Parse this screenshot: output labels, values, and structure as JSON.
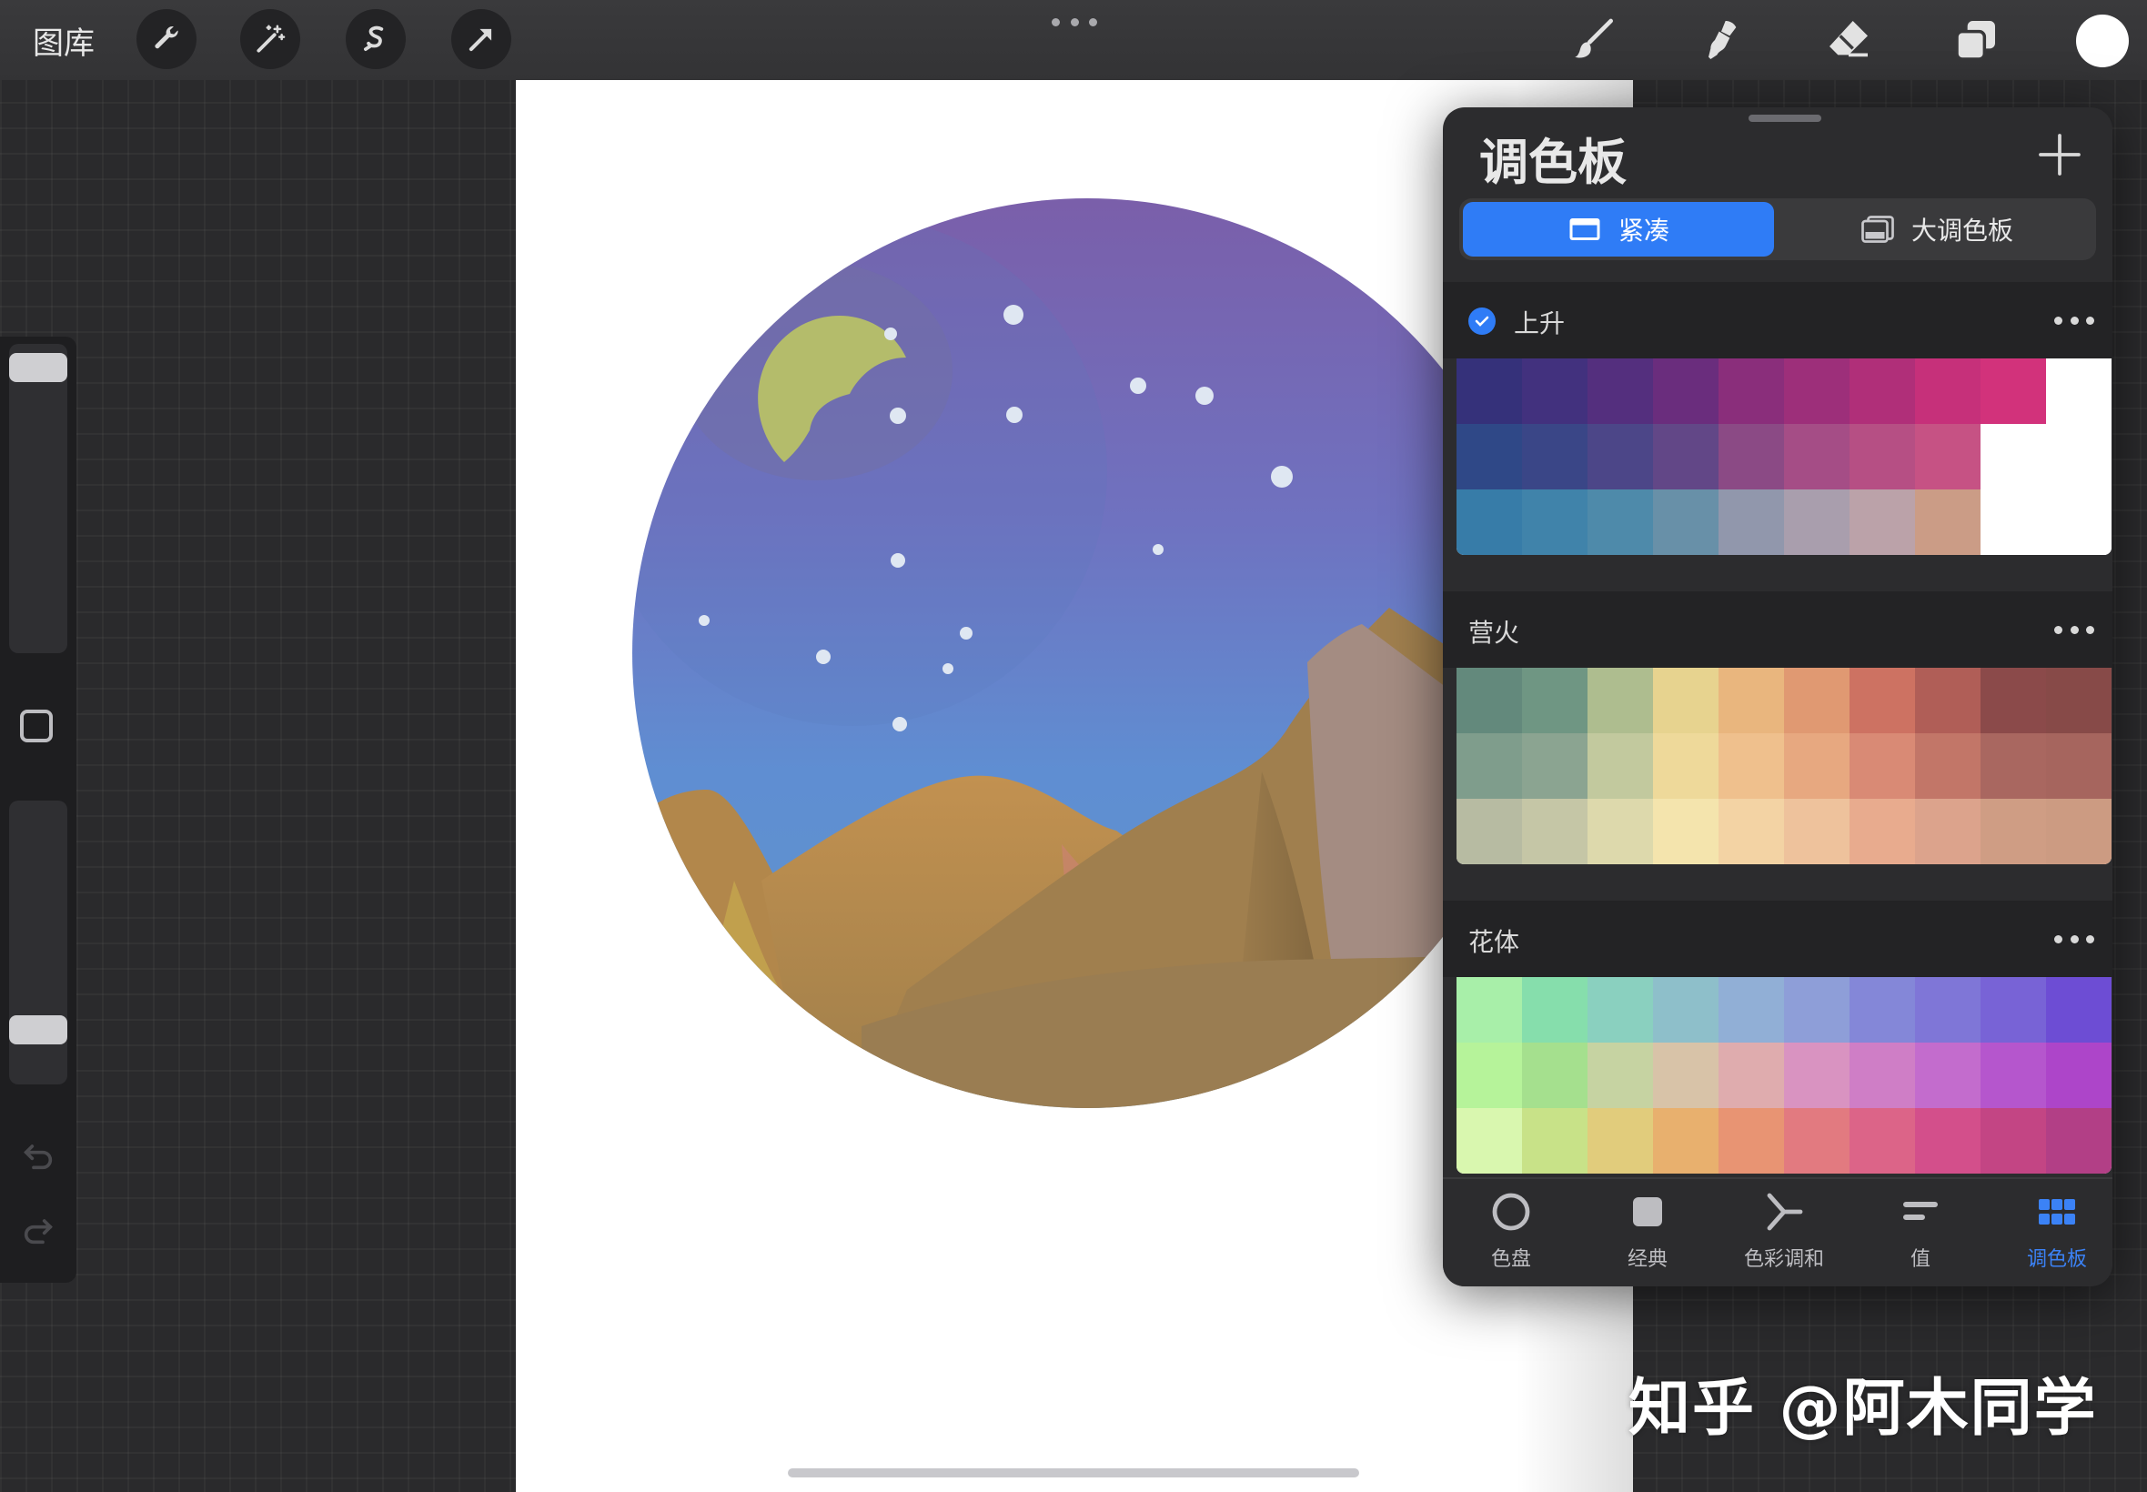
{
  "topbar": {
    "gallery_label": "图库",
    "left_tools": [
      "wrench-icon",
      "magic-wand-icon",
      "selection-icon",
      "transform-icon"
    ],
    "right_tools": [
      "brush-icon",
      "smudge-icon",
      "eraser-icon",
      "layers-icon"
    ],
    "current_color": "#ffffff"
  },
  "panel": {
    "title": "调色板",
    "segments": [
      {
        "label": "紧凑",
        "active": true
      },
      {
        "label": "大调色板",
        "active": false
      }
    ],
    "palettes": [
      {
        "name": "上升",
        "default": true,
        "colors": [
          [
            "#35317a",
            "#42317e",
            "#542f7e",
            "#6a2d7d",
            "#8a2e7b",
            "#9d2f7a",
            "#b02f79",
            "#c6307a",
            "#d2327b",
            "#ffffff"
          ],
          [
            "#2f4887",
            "#3a4687",
            "#4c4688",
            "#624787",
            "#8b4a85",
            "#a54d86",
            "#b64f84",
            "#c65284",
            "#ffffff",
            "#ffffff"
          ],
          [
            "#377ca8",
            "#4083aa",
            "#4e8aaa",
            "#6890a8",
            "#9197ac",
            "#a99ead",
            "#bba2a9",
            "#cb9c86",
            "#ffffff",
            "#ffffff"
          ]
        ]
      },
      {
        "name": "营火",
        "default": false,
        "colors": [
          [
            "#63897c",
            "#6f9683",
            "#aebd8f",
            "#e7d38f",
            "#e9b67e",
            "#e09972",
            "#cd7262",
            "#b05e57",
            "#8b4a4a",
            "#874a48"
          ],
          [
            "#7f9d8c",
            "#8ba491",
            "#c2c99e",
            "#eed99a",
            "#efc08d",
            "#e7a880",
            "#d98a75",
            "#c27668",
            "#a96760",
            "#a6655e"
          ],
          [
            "#b7bba2",
            "#c5c6a6",
            "#ddd9ac",
            "#f4e4ad",
            "#f3d3a4",
            "#eec29c",
            "#e8ab8e",
            "#dca38c",
            "#cf9d84",
            "#cc9b82"
          ]
        ]
      },
      {
        "name": "花体",
        "default": false,
        "colors": [
          [
            "#a8efa9",
            "#86deac",
            "#8ad0bf",
            "#8ebfca",
            "#91afd6",
            "#8e9ed8",
            "#8487d8",
            "#7f76d7",
            "#7863d6",
            "#6d4dd4"
          ],
          [
            "#b6f39a",
            "#a5e08e",
            "#c6d3a2",
            "#d8c3a8",
            "#dfacae",
            "#d993c1",
            "#cf7ec6",
            "#c36ccd",
            "#b556cd",
            "#ad45c9"
          ],
          [
            "#d9f7af",
            "#c8e288",
            "#e1cc7c",
            "#e8b06e",
            "#e89473",
            "#e27a80",
            "#dc6488",
            "#d34f8b",
            "#c34584",
            "#b23f86"
          ]
        ]
      }
    ],
    "tabs": [
      {
        "label": "色盘",
        "icon": "color-disc-icon",
        "active": false
      },
      {
        "label": "经典",
        "icon": "classic-icon",
        "active": false
      },
      {
        "label": "色彩调和",
        "icon": "harmony-icon",
        "active": false
      },
      {
        "label": "值",
        "icon": "value-icon",
        "active": false
      },
      {
        "label": "调色板",
        "icon": "palettes-icon",
        "active": true
      }
    ]
  },
  "watermark": "知乎 @阿木同学",
  "colors": {
    "accent": "#2f7cf6",
    "panel_bg": "#2c2c2e",
    "canvas_bg": "#ffffff"
  }
}
